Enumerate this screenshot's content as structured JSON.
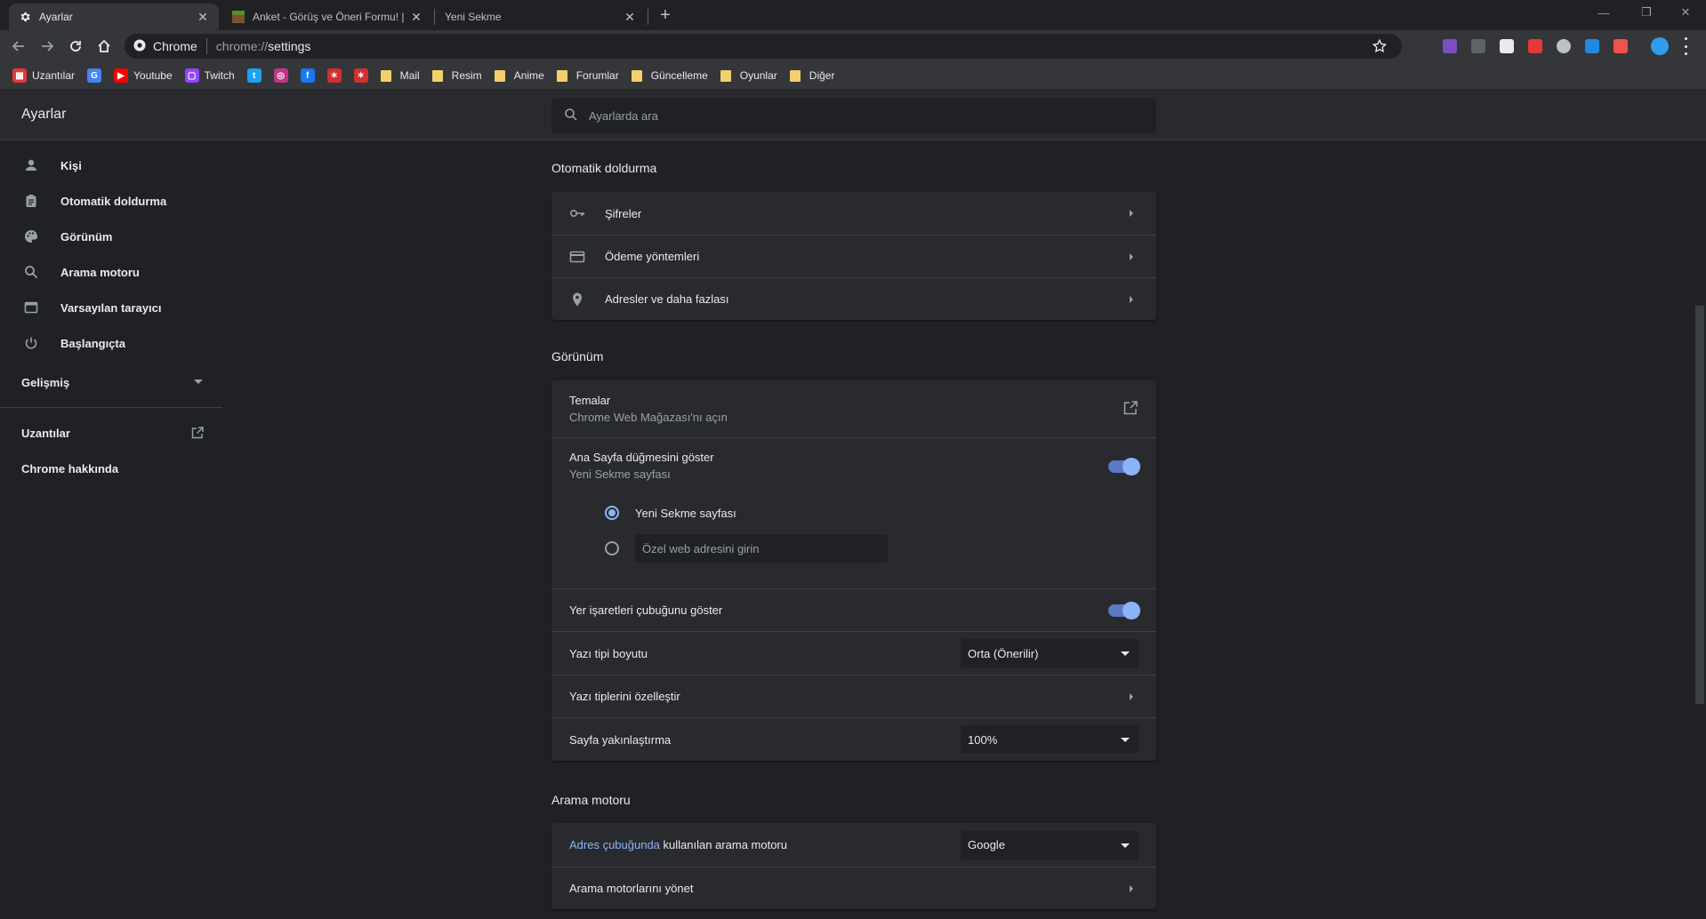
{
  "tabs": [
    {
      "title": "Ayarlar",
      "close": "✕"
    },
    {
      "title": "Anket - Görüş ve Öneri Formu! |",
      "close": "✕"
    },
    {
      "title": "Yeni Sekme",
      "close": "✕"
    }
  ],
  "newtab_label": "+",
  "window_controls": {
    "minimize": "—",
    "restore": "❐",
    "close": "✕"
  },
  "omnibox": {
    "chip": "Chrome",
    "scheme": "chrome://",
    "path": "settings"
  },
  "bookmarks": [
    {
      "label": "Uzantılar",
      "icon": "apps-icon",
      "color": "#e53935"
    },
    {
      "label": "",
      "icon": "translate-icon",
      "color": "#4285f4"
    },
    {
      "label": "Youtube",
      "icon": "youtube-icon",
      "color": "#ff0000"
    },
    {
      "label": "Twitch",
      "icon": "twitch-icon",
      "color": "#9146ff"
    },
    {
      "label": "",
      "icon": "twitter-icon",
      "color": "#1da1f2"
    },
    {
      "label": "",
      "icon": "instagram-icon",
      "color": "#c13584"
    },
    {
      "label": "",
      "icon": "facebook-icon",
      "color": "#1877f2"
    },
    {
      "label": "",
      "icon": "runner-icon",
      "color": "#d32f2f"
    },
    {
      "label": "",
      "icon": "runner-icon",
      "color": "#d32f2f"
    },
    {
      "label": "Mail",
      "icon": "folder-icon"
    },
    {
      "label": "Resim",
      "icon": "folder-icon"
    },
    {
      "label": "Anime",
      "icon": "folder-icon"
    },
    {
      "label": "Forumlar",
      "icon": "folder-icon"
    },
    {
      "label": "Güncelleme",
      "icon": "folder-icon"
    },
    {
      "label": "Oyunlar",
      "icon": "folder-icon"
    },
    {
      "label": "Diğer",
      "icon": "folder-icon"
    }
  ],
  "settings": {
    "title": "Ayarlar",
    "search_placeholder": "Ayarlarda ara"
  },
  "nav": {
    "items": [
      {
        "label": "Kişi",
        "icon": "person-icon"
      },
      {
        "label": "Otomatik doldurma",
        "icon": "clipboard-icon"
      },
      {
        "label": "Görünüm",
        "icon": "palette-icon"
      },
      {
        "label": "Arama motoru",
        "icon": "search-icon"
      },
      {
        "label": "Varsayılan tarayıcı",
        "icon": "browser-icon"
      },
      {
        "label": "Başlangıçta",
        "icon": "power-icon"
      }
    ],
    "advanced": "Gelişmiş",
    "extensions": "Uzantılar",
    "about": "Chrome hakkında"
  },
  "autofill": {
    "title": "Otomatik doldurma",
    "rows": [
      {
        "label": "Şifreler",
        "icon": "key-icon"
      },
      {
        "label": "Ödeme yöntemleri",
        "icon": "credit-card-icon"
      },
      {
        "label": "Adresler ve daha fazlası",
        "icon": "location-pin-icon"
      }
    ]
  },
  "appearance": {
    "title": "Görünüm",
    "themes_label": "Temalar",
    "themes_sub": "Chrome Web Mağazası'nı açın",
    "home_label": "Ana Sayfa düğmesini göster",
    "home_sub": "Yeni Sekme sayfası",
    "home_on": true,
    "radio_newtab": "Yeni Sekme sayfası",
    "custom_url_placeholder": "Özel web adresini girin",
    "bookmarks_bar_label": "Yer işaretleri çubuğunu göster",
    "bookmarks_bar_on": true,
    "font_size_label": "Yazı tipi boyutu",
    "font_size_value": "Orta (Önerilir)",
    "customize_fonts_label": "Yazı tiplerini özelleştir",
    "zoom_label": "Sayfa yakınlaştırma",
    "zoom_value": "100%"
  },
  "search_engine": {
    "title": "Arama motoru",
    "address_bar_link": "Adres çubuğunda",
    "address_bar_rest": " kullanılan arama motoru",
    "engine_value": "Google",
    "manage_label": "Arama motorlarını yönet"
  },
  "colors": {
    "accent": "#8ab4f8",
    "background": "#202124",
    "card": "#292a2d"
  }
}
